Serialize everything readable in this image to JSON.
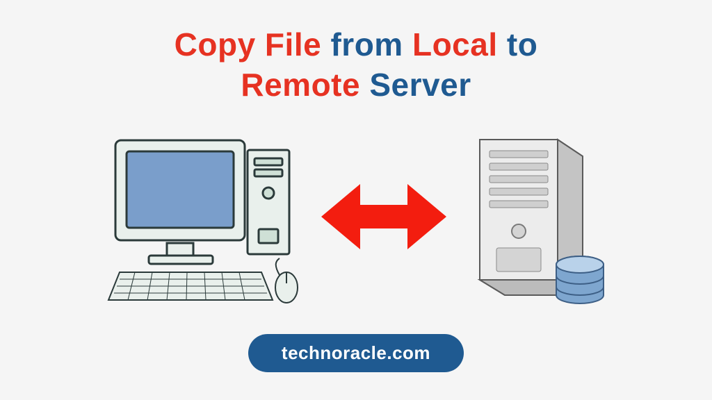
{
  "title": {
    "parts": [
      {
        "text": "Copy File",
        "cls": "t-red"
      },
      {
        "text": " from ",
        "cls": "t-blue"
      },
      {
        "text": "Local",
        "cls": "t-red"
      },
      {
        "text": " to",
        "cls": "t-blue"
      },
      {
        "text": "Remote",
        "cls": "t-red"
      },
      {
        "text": " Server",
        "cls": "t-blue"
      }
    ]
  },
  "badge": {
    "label": "technoracle.com"
  },
  "colors": {
    "red": "#E63222",
    "blue": "#1F5A91",
    "bg": "#f5f5f5"
  },
  "icons": {
    "local": "desktop-computer-icon",
    "transfer": "bidirectional-arrow-icon",
    "remote": "server-tower-icon",
    "storage": "database-cylinder-icon"
  }
}
